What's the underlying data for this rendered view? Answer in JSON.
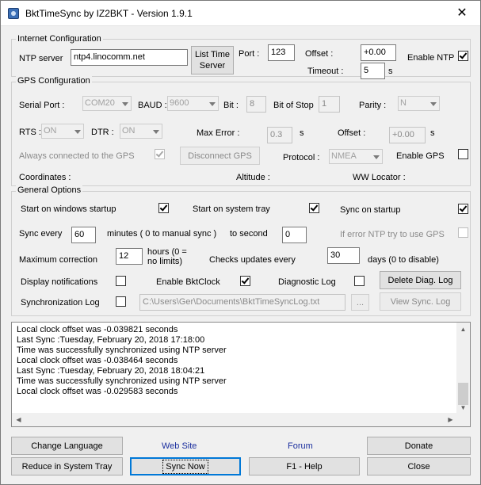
{
  "window": {
    "title": "BktTimeSync by IZ2BKT - Version 1.9.1",
    "close": "✕"
  },
  "internet": {
    "legend": "Internet Configuration",
    "ntp_label": "NTP server",
    "ntp_value": "ntp4.linocomm.net",
    "list_button": "List Time Server",
    "port_label": "Port :",
    "port_value": "123",
    "offset_label": "Offset :",
    "offset_value": "+0.00",
    "timeout_label": "Timeout :",
    "timeout_value": "5",
    "timeout_unit": "s",
    "enable_ntp_label": "Enable NTP",
    "enable_ntp": true
  },
  "gps": {
    "legend": "GPS Configuration",
    "serial_label": "Serial Port :",
    "serial_value": "COM20",
    "baud_label": "BAUD :",
    "baud_value": "9600",
    "bit_label": "Bit :",
    "bit_value": "8",
    "stop_label": "Bit of Stop",
    "stop_value": "1",
    "parity_label": "Parity :",
    "parity_value": "N",
    "rts_label": "RTS :",
    "rts_value": "ON",
    "dtr_label": "DTR :",
    "dtr_value": "ON",
    "max_error_label": "Max Error :",
    "max_error_value": "0.3",
    "max_error_unit": "s",
    "offset_label": "Offset :",
    "offset_value": "+0.00",
    "offset_unit": "s",
    "always_label": "Always connected to the GPS",
    "always_checked": true,
    "disconnect_button": "Disconnect GPS",
    "protocol_label": "Protocol :",
    "protocol_value": "NMEA",
    "enable_gps_label": "Enable GPS",
    "enable_gps": false,
    "coordinates_label": "Coordinates :",
    "altitude_label": "Altitude :",
    "locator_label": "WW Locator :"
  },
  "general": {
    "legend": "General Options",
    "start_windows_label": "Start on windows startup",
    "start_windows": true,
    "start_tray_label": "Start on system tray",
    "start_tray": true,
    "sync_startup_label": "Sync on startup",
    "sync_startup": true,
    "sync_every_label": "Sync every",
    "sync_every_value": "60",
    "minutes_label": "minutes ( 0 to manual sync )",
    "to_second_label": "to second",
    "to_second_value": "0",
    "if_error_label": "If error NTP try to use GPS",
    "if_error": false,
    "max_correction_label": "Maximum correction",
    "max_correction_value": "12",
    "hours_label_1": "hours (0 =",
    "hours_label_2": "no limits)",
    "checks_label": "Checks updates every",
    "checks_value": "30",
    "days_label": "days (0 to disable)",
    "notif_label": "Display notifications",
    "notif": false,
    "bktclock_label": "Enable BktClock",
    "bktclock": true,
    "diag_label": "Diagnostic Log",
    "diag": false,
    "delete_diag_button": "Delete Diag. Log",
    "sync_log_label": "Synchronization Log",
    "sync_log": false,
    "log_path": "C:\\Users\\Ger\\Documents\\BktTimeSyncLog.txt",
    "browse_button": "...",
    "view_sync_button": "View Sync. Log"
  },
  "log": {
    "lines": [
      "Local clock offset was -0.039821 seconds",
      "Last Sync :Tuesday, February 20, 2018 17:18:00",
      "Time was successfully synchronized using NTP server",
      "Local clock offset was -0.038464 seconds",
      "Last Sync :Tuesday, February 20, 2018 18:04:21",
      "Time was successfully synchronized using NTP server",
      "Local clock offset was -0.029583 seconds"
    ]
  },
  "bottom": {
    "change_language": "Change Language",
    "web_site": "Web Site",
    "forum": "Forum",
    "donate": "Donate",
    "reduce_tray": "Reduce in System Tray",
    "sync_now": "Sync Now",
    "help": "F1 - Help",
    "close": "Close"
  }
}
